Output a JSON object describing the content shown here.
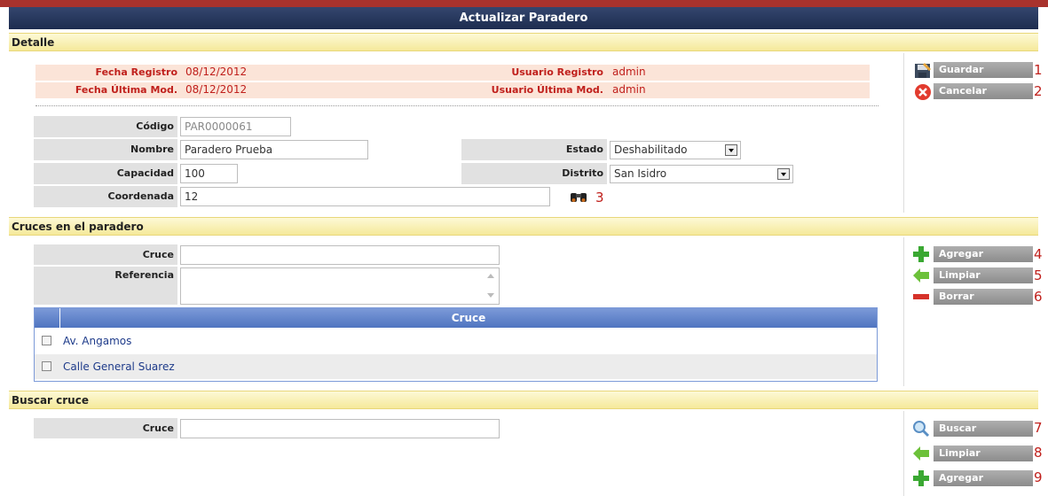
{
  "window": {
    "title": "Actualizar Paradero"
  },
  "sections": {
    "detalle": "Detalle",
    "cruces": "Cruces en el paradero",
    "buscar": "Buscar cruce"
  },
  "audit": {
    "fecha_registro_label": "Fecha Registro",
    "fecha_registro": "08/12/2012",
    "fecha_mod_label": "Fecha Última Mod.",
    "fecha_mod": "08/12/2012",
    "usuario_registro_label": "Usuario Registro",
    "usuario_registro": "admin",
    "usuario_mod_label": "Usuario Última Mod.",
    "usuario_mod": "admin"
  },
  "form": {
    "codigo_label": "Código",
    "codigo": "PAR0000061",
    "nombre_label": "Nombre",
    "nombre": "Paradero Prueba",
    "capacidad_label": "Capacidad",
    "capacidad": "100",
    "coordenada_label": "Coordenada",
    "coordenada": "12",
    "estado_label": "Estado",
    "estado": "Deshabilitado",
    "distrito_label": "Distrito",
    "distrito": "San Isidro"
  },
  "cruces": {
    "cruce_label": "Cruce",
    "cruce": "",
    "referencia_label": "Referencia",
    "referencia": "",
    "grid_header": "Cruce",
    "rows": [
      {
        "name": "Av. Angamos"
      },
      {
        "name": "Calle General Suarez"
      }
    ]
  },
  "buscar": {
    "cruce_label": "Cruce",
    "cruce": ""
  },
  "buttons": {
    "guardar": "Guardar",
    "cancelar": "Cancelar",
    "agregar": "Agregar",
    "limpiar": "Limpiar",
    "borrar": "Borrar",
    "buscar": "Buscar",
    "limpiar2": "Limpiar",
    "agregar2": "Agregar"
  },
  "markers": {
    "m1": "1",
    "m2": "2",
    "m3": "3",
    "m4": "4",
    "m5": "5",
    "m6": "6",
    "m7": "7",
    "m8": "8",
    "m9": "9"
  },
  "icons": [
    "save-icon",
    "cancel-icon",
    "binoculars-icon",
    "plus-icon",
    "arrow-left-icon",
    "minus-icon",
    "magnifier-icon"
  ],
  "colors": {
    "title_bar": "#1d2c4f",
    "accent_red": "#c0201c",
    "section": "#f5e99a",
    "grid_header": "#4f74c0"
  }
}
